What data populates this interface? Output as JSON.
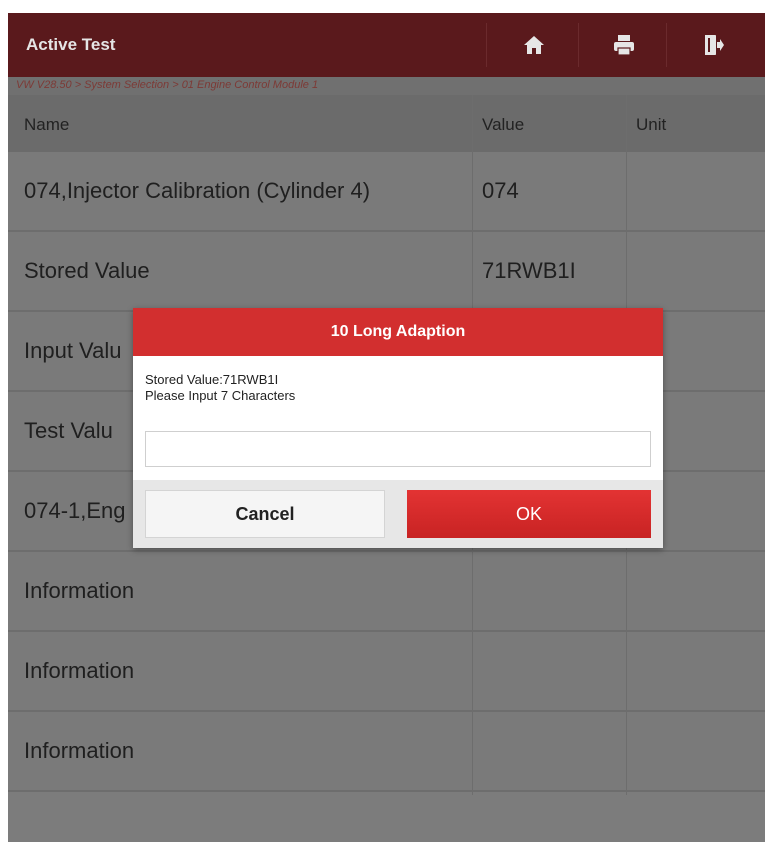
{
  "window": {
    "title": "Active Test"
  },
  "toolbar": {
    "home_icon": "home-icon",
    "print_icon": "print-icon",
    "exit_icon": "exit-icon"
  },
  "breadcrumb": "VW V28.50 > System Selection > 01 Engine Control Module 1",
  "table": {
    "columns": [
      "Name",
      "Value",
      "Unit"
    ],
    "rows": [
      {
        "name": "074,Injector Calibration (Cylinder 4)",
        "value": "074",
        "unit": ""
      },
      {
        "name": "Stored Value",
        "value": "71RWB1I",
        "unit": ""
      },
      {
        "name": "Input Valu",
        "value": "",
        "unit": ""
      },
      {
        "name": "Test Valu",
        "value": "",
        "unit": ""
      },
      {
        "name": "074-1,Eng",
        "value": "",
        "unit": ""
      },
      {
        "name": "Information",
        "value": "",
        "unit": ""
      },
      {
        "name": "Information",
        "value": "",
        "unit": ""
      },
      {
        "name": "Information",
        "value": "",
        "unit": ""
      }
    ]
  },
  "dialog": {
    "title": "10 Long Adaption",
    "message_line1": "Stored Value:71RWB1I",
    "message_line2": "Please Input  7 Characters",
    "input_value": "",
    "cancel_label": "Cancel",
    "ok_label": "OK"
  },
  "colors": {
    "titlebar": "#5a191c",
    "dialog_header": "#d22f2f",
    "ok_button": "#d22f2f",
    "overlay_bg": "#7c7c7c"
  }
}
